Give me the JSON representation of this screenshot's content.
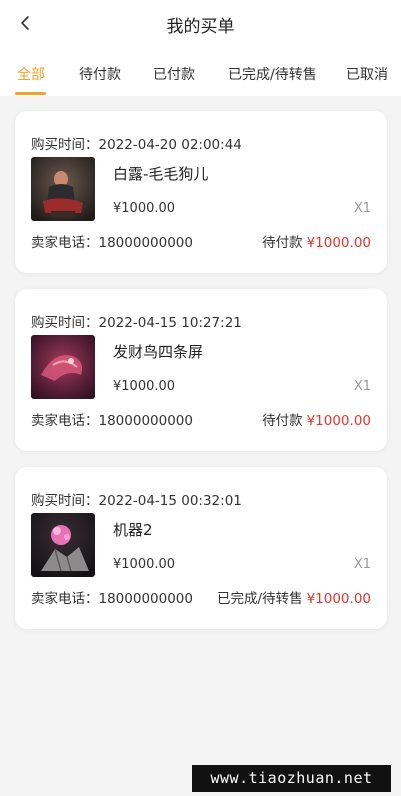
{
  "header": {
    "title": "我的买单",
    "back_icon": "chevron-left-icon"
  },
  "tabs": [
    {
      "label": "全部",
      "active": true
    },
    {
      "label": "待付款",
      "active": false
    },
    {
      "label": "已付款",
      "active": false
    },
    {
      "label": "已完成/待转售",
      "active": false
    },
    {
      "label": "已取消",
      "active": false
    }
  ],
  "orders": [
    {
      "time": "购买时间：2022-04-20 02:00:44",
      "name": "白露-毛毛狗儿",
      "price": "¥1000.00",
      "qty": "X1",
      "phone": "卖家电话：18000000000",
      "status": "待付款",
      "total": "¥1000.00"
    },
    {
      "time": "购买时间：2022-04-15 10:27:21",
      "name": "发财鸟四条屏",
      "price": "¥1000.00",
      "qty": "X1",
      "phone": "卖家电话：18000000000",
      "status": "待付款",
      "total": "¥1000.00"
    },
    {
      "time": "购买时间：2022-04-15 00:32:01",
      "name": "机器2",
      "price": "¥1000.00",
      "qty": "X1",
      "phone": "卖家电话：18000000000",
      "status": "已完成/待转售",
      "total": "¥1000.00"
    }
  ],
  "watermark": "www.tiaozhuan.net",
  "colors": {
    "accent": "#f0a42a",
    "price_red": "#e8342b",
    "background": "#f4f4f4"
  }
}
